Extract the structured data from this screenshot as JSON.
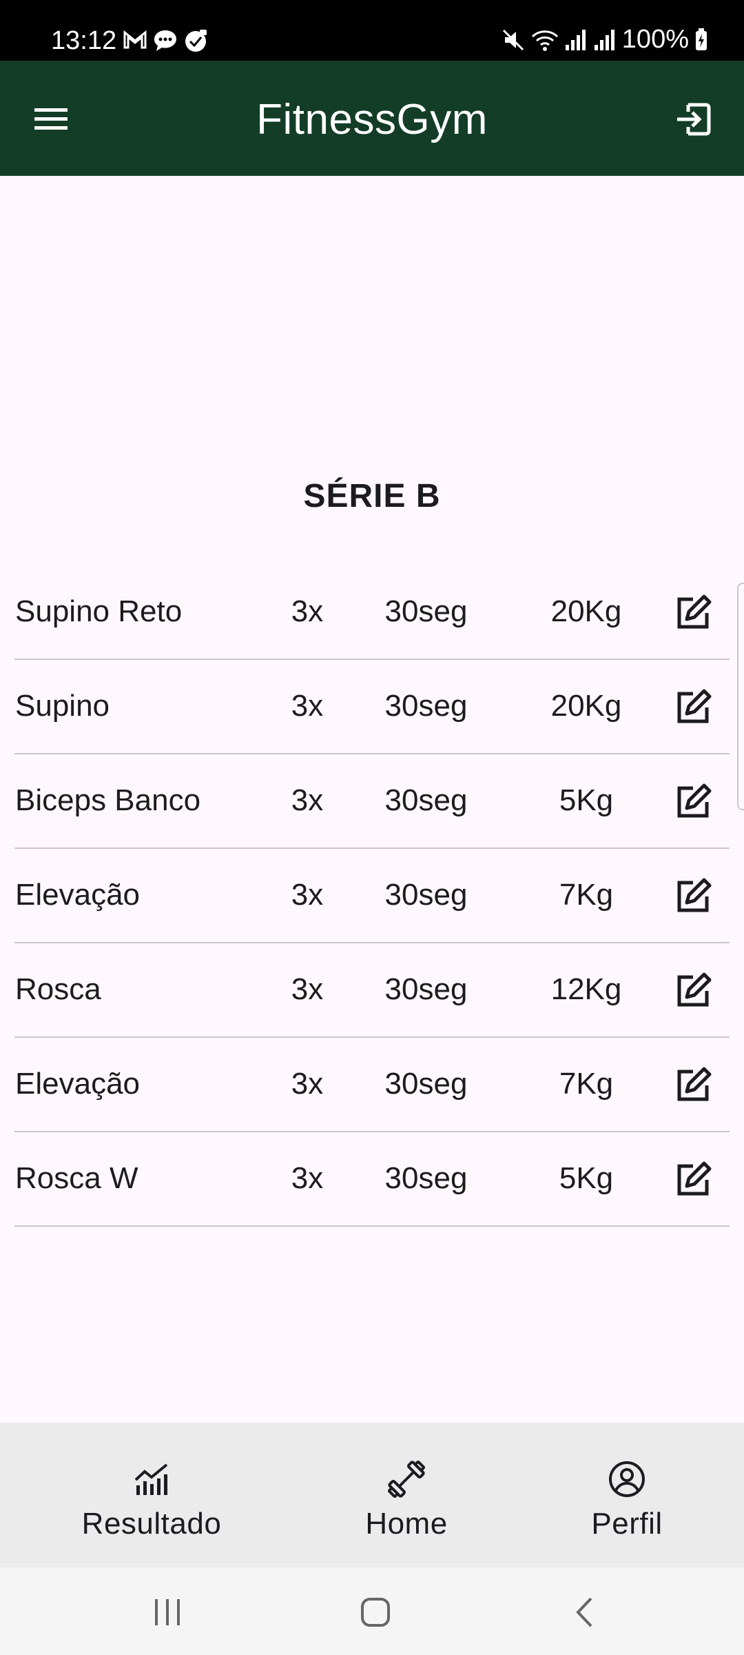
{
  "status_bar": {
    "time": "13:12",
    "battery": "100%",
    "notification_icons": [
      "gmail-icon",
      "chat-icon",
      "app-icon"
    ],
    "system_icons": [
      "mute-icon",
      "wifi-icon",
      "signal-icon",
      "signal-icon",
      "battery-charging-icon"
    ]
  },
  "app_bar": {
    "title": "FitnessGym",
    "background": "#133d27"
  },
  "series": {
    "title": "SÉRIE B"
  },
  "exercises": [
    {
      "name": "Supino Reto",
      "sets": "3x",
      "rest": "30seg",
      "load": "20Kg"
    },
    {
      "name": "Supino",
      "sets": "3x",
      "rest": "30seg",
      "load": "20Kg"
    },
    {
      "name": "Biceps Banco",
      "sets": "3x",
      "rest": "30seg",
      "load": "5Kg"
    },
    {
      "name": "Elevação",
      "sets": "3x",
      "rest": "30seg",
      "load": "7Kg"
    },
    {
      "name": "Rosca",
      "sets": "3x",
      "rest": "30seg",
      "load": "12Kg"
    },
    {
      "name": "Elevação",
      "sets": "3x",
      "rest": "30seg",
      "load": "7Kg"
    },
    {
      "name": "Rosca W",
      "sets": "3x",
      "rest": "30seg",
      "load": "5Kg"
    }
  ],
  "bottom_nav": {
    "items": [
      {
        "label": "Resultado",
        "icon": "chart-icon"
      },
      {
        "label": "Home",
        "icon": "dumbbell-icon"
      },
      {
        "label": "Perfil",
        "icon": "profile-icon"
      }
    ],
    "background": "#ebebeb"
  },
  "system_nav": {
    "buttons": [
      "recent-apps-icon",
      "home-icon",
      "back-icon"
    ]
  }
}
